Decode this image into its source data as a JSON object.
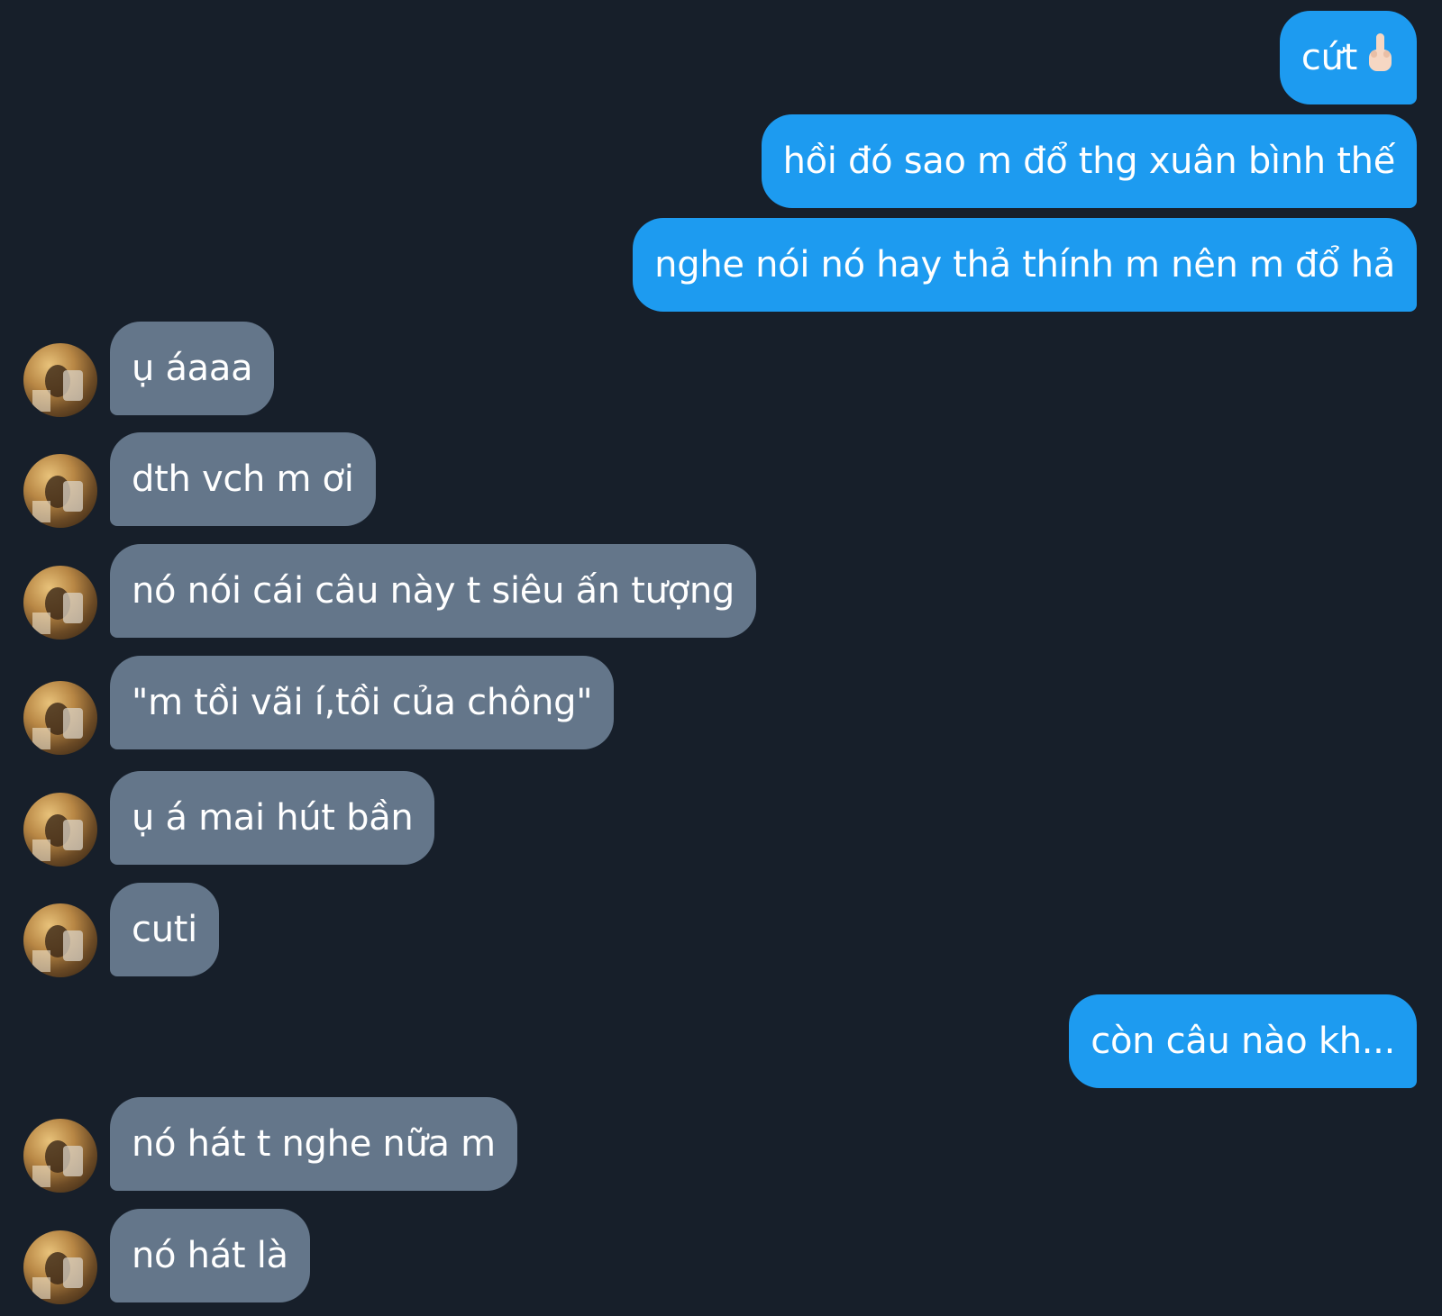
{
  "messages": [
    {
      "dir": "out",
      "text": "cứt",
      "icon": "middle-finger-icon"
    },
    {
      "dir": "out",
      "text": "hồi đó sao m đổ thg xuân bình thế"
    },
    {
      "dir": "out",
      "text": "nghe nói nó hay thả thính m nên m đổ hả"
    },
    {
      "dir": "in",
      "text": "ụ áaaa"
    },
    {
      "dir": "in",
      "text": "dth vch m ơi"
    },
    {
      "dir": "in",
      "text": "nó nói cái câu này t siêu ấn tượng"
    },
    {
      "dir": "in",
      "text": "\"m tồi vãi í,tồi của chông\""
    },
    {
      "dir": "in",
      "text": "ụ á mai hút bần"
    },
    {
      "dir": "in",
      "text": "cuti"
    },
    {
      "dir": "out",
      "text": "còn câu nào kh..."
    },
    {
      "dir": "in",
      "text": "nó hát t nghe nữa m"
    },
    {
      "dir": "in",
      "text": "nó hát là"
    }
  ],
  "colors": {
    "background": "#171f2a",
    "outgoing_bubble": "#1d9bf0",
    "incoming_bubble": "#64768a",
    "text": "#ffffff"
  }
}
